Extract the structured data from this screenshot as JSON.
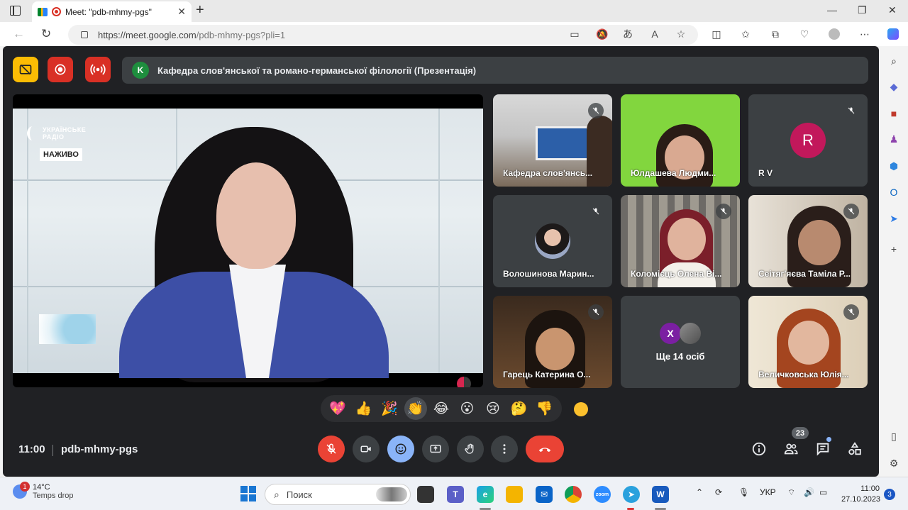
{
  "browser": {
    "tab_title": "Meet: \"pdb-mhmy-pgs\"",
    "url_host": "https://meet.google.com",
    "url_path": "/pdb-mhmy-pgs?pli=1"
  },
  "meet": {
    "presentation_initial": "K",
    "presentation_title": "Кафедра слов'янської та романо-германської філології (Презентація)",
    "main_video": {
      "logo_line1": "УКРАЇНСЬКЕ",
      "logo_line2": "РАДІО",
      "live_label": "НАЖИВО"
    },
    "tiles": [
      {
        "name": "Кафедра слов'янсь...",
        "muted": true
      },
      {
        "name": "Юлдашева Людми...",
        "muted": false
      },
      {
        "name": "R V",
        "initial": "R",
        "avatar_color": "#c2185b",
        "muted": true
      },
      {
        "name": "Волошинова Марин...",
        "muted": true
      },
      {
        "name": "Коломієць Олена Ві...",
        "muted": true
      },
      {
        "name": "Сеітяг'яєва Таміла Р...",
        "muted": true
      },
      {
        "name": "Гарець Катерина О...",
        "muted": true
      },
      {
        "name": "Ще 14 осіб",
        "initial": "X",
        "avatar_color": "#7b1fa2",
        "muted": false
      },
      {
        "name": "Величковська Юлія...",
        "muted": true
      }
    ],
    "reactions": [
      "💖",
      "👍",
      "🎉",
      "👏",
      "😂",
      "😮",
      "😢",
      "🤔",
      "👎"
    ],
    "clock": "11:00",
    "meeting_code": "pdb-mhmy-pgs",
    "participants_count": "23"
  },
  "taskbar": {
    "temperature": "14°C",
    "weather_desc": "Temps drop",
    "weather_badge": "1",
    "search_placeholder": "Поиск",
    "language": "УКР",
    "time": "11:00",
    "date": "27.10.2023",
    "notifications": "3"
  },
  "colors": {
    "meet_bg": "#202124",
    "tile_bg": "#3c4043",
    "accent_red": "#ea4335",
    "accent_blue": "#8ab4f8",
    "record_yellow": "#fbbc04"
  }
}
